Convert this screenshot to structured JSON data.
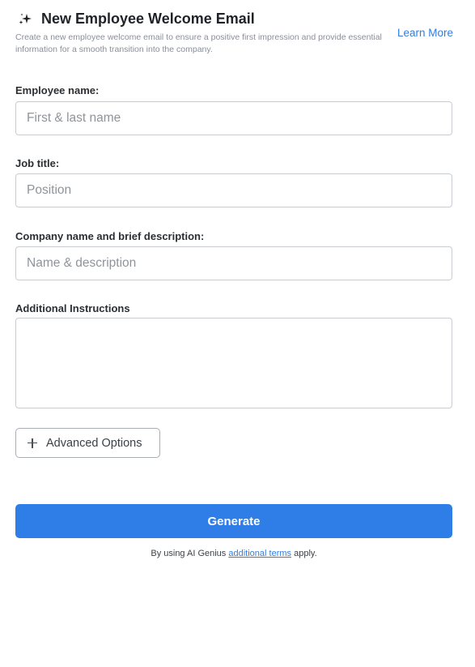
{
  "header": {
    "title": "New Employee Welcome Email",
    "subtitle": "Create a new employee welcome email to ensure a positive first impression and provide essential information for a smooth transition into the company.",
    "learn_more": "Learn More",
    "icon": "sparkle-icon"
  },
  "form": {
    "employee_name": {
      "label": "Employee name:",
      "value": "",
      "placeholder": "First & last name"
    },
    "job_title": {
      "label": "Job title:",
      "value": "",
      "placeholder": "Position"
    },
    "company": {
      "label": "Company name and brief description:",
      "value": "",
      "placeholder": "Name & description"
    },
    "instructions": {
      "label": "Additional Instructions",
      "value": "",
      "placeholder": ""
    },
    "advanced_options": {
      "label": "Advanced Options",
      "icon": "plus-icon"
    },
    "generate": {
      "label": "Generate"
    }
  },
  "footer": {
    "prefix": "By using AI Genius",
    "link": "additional terms",
    "suffix": "apply."
  },
  "colors": {
    "accent": "#2f7ee8",
    "link": "#2f7de1",
    "border": "#c9cdd2",
    "muted_text": "#8a8f98"
  }
}
